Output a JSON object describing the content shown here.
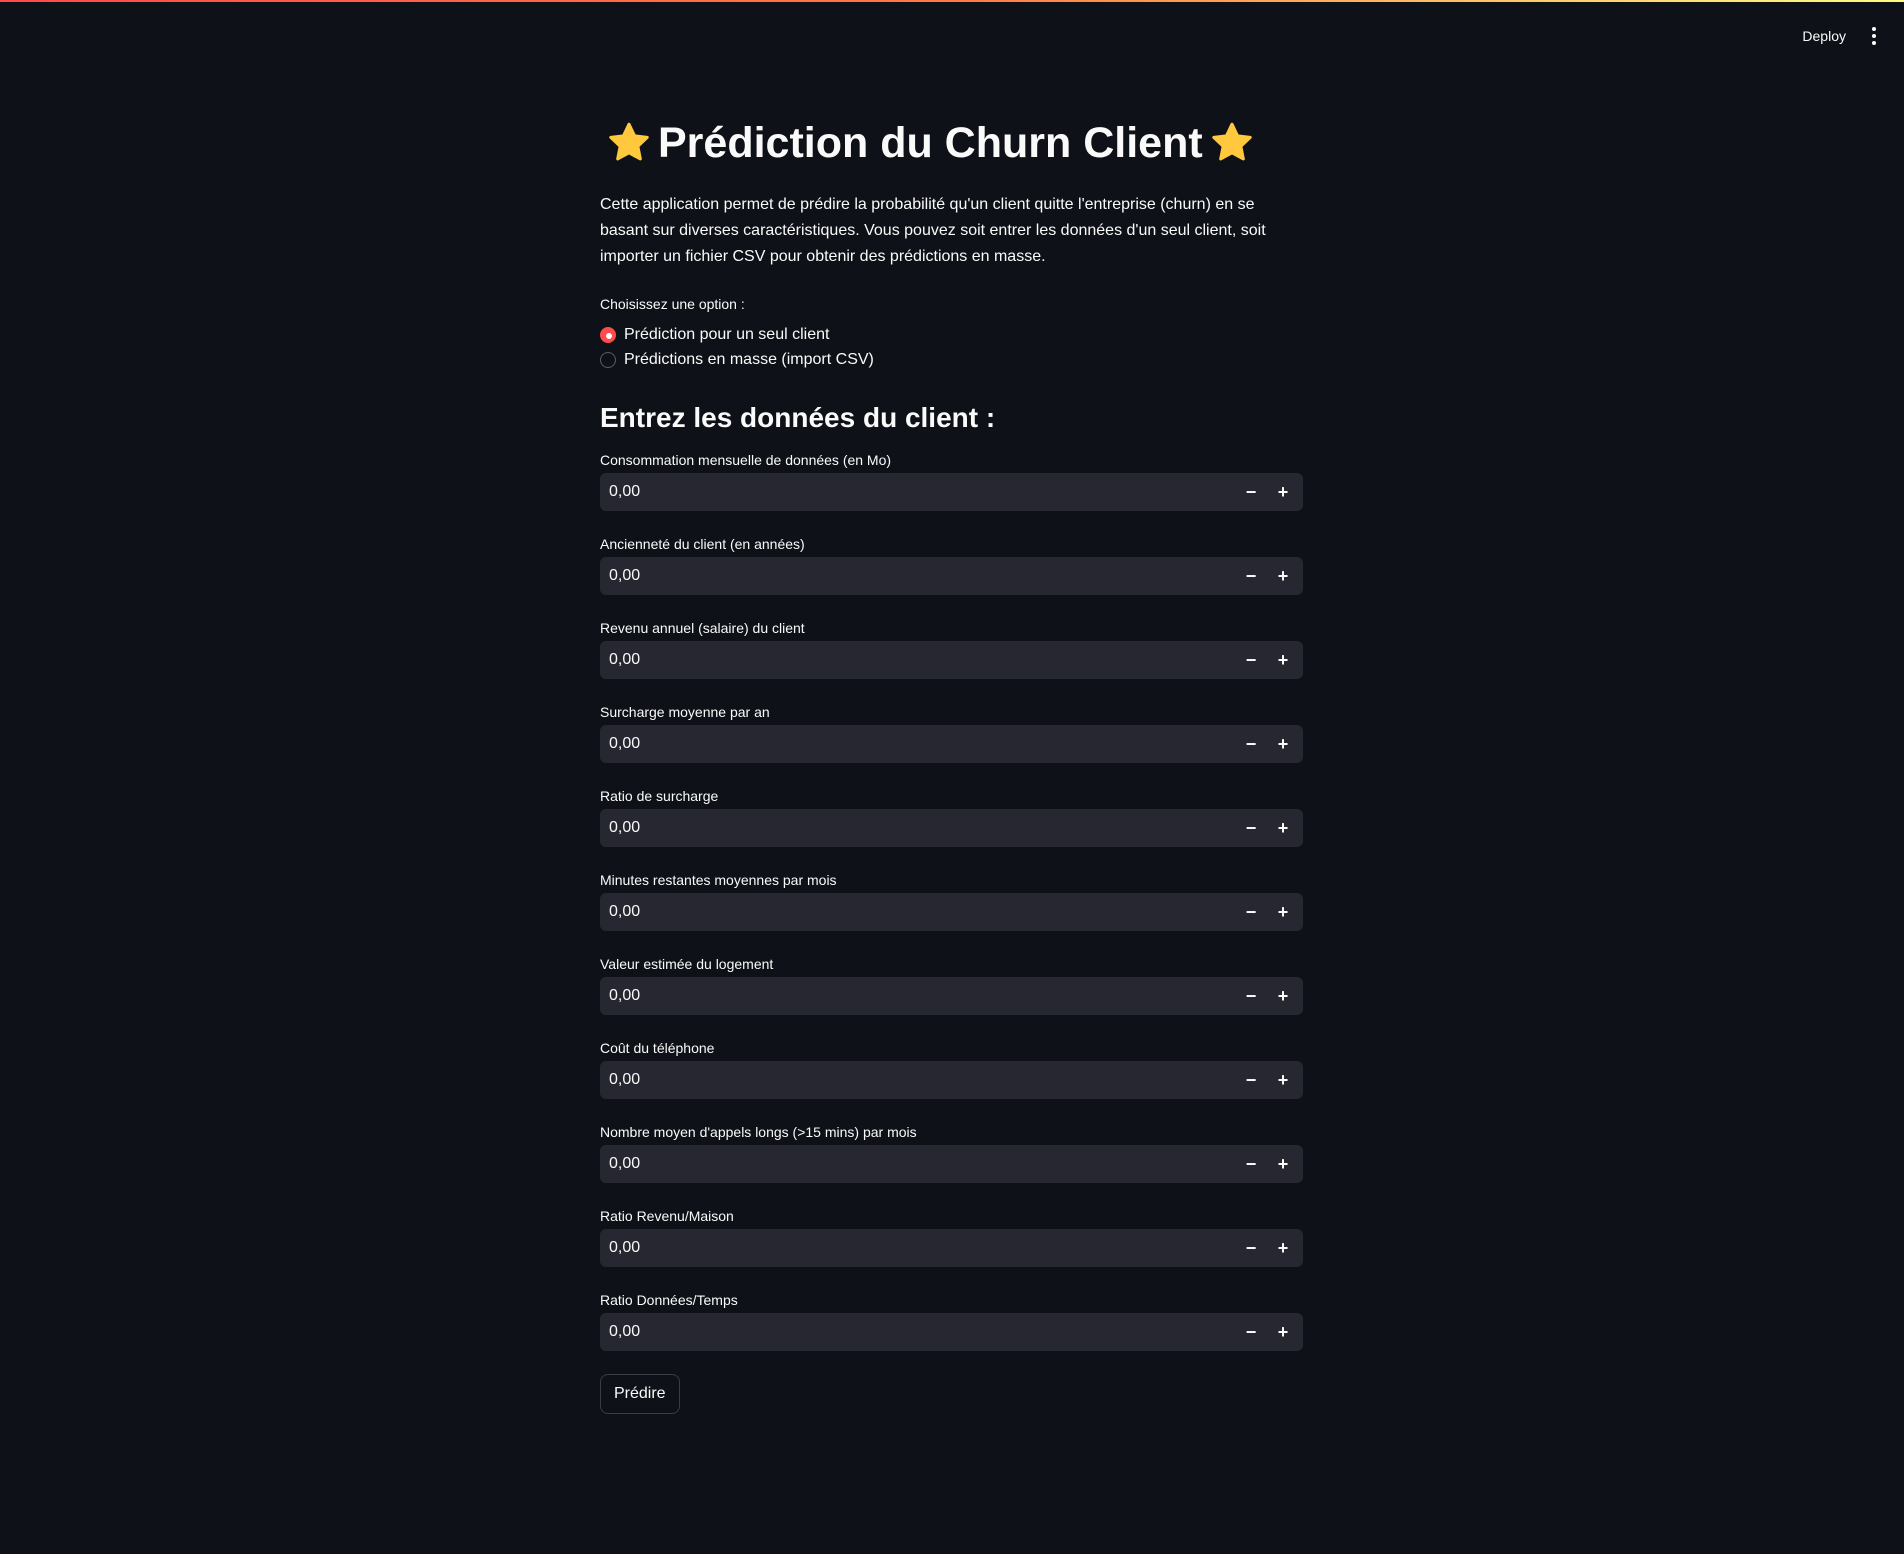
{
  "header": {
    "deploy_label": "Deploy",
    "menu_icon": "vertical-dots-icon"
  },
  "title": {
    "icon_left": "star-icon",
    "text": "Prédiction du Churn Client",
    "icon_right": "star-icon",
    "star_color": "#ffc83d"
  },
  "intro": "Cette application permet de prédire la probabilité qu'un client quitte l'entreprise (churn) en se basant sur diverses caractéristiques. Vous pouvez soit entrer les données d'un seul client, soit importer un fichier CSV pour obtenir des prédictions en masse.",
  "mode": {
    "label": "Choisissez une option :",
    "options": [
      {
        "label": "Prédiction pour un seul client",
        "selected": true
      },
      {
        "label": "Prédictions en masse (import CSV)",
        "selected": false
      }
    ]
  },
  "form": {
    "heading": "Entrez les données du client :",
    "fields": [
      {
        "label": "Consommation mensuelle de données (en Mo)",
        "value": "0,00"
      },
      {
        "label": "Ancienneté du client (en années)",
        "value": "0,00"
      },
      {
        "label": "Revenu annuel (salaire) du client",
        "value": "0,00"
      },
      {
        "label": "Surcharge moyenne par an",
        "value": "0,00"
      },
      {
        "label": "Ratio de surcharge",
        "value": "0,00"
      },
      {
        "label": "Minutes restantes moyennes par mois",
        "value": "0,00"
      },
      {
        "label": "Valeur estimée du logement",
        "value": "0,00"
      },
      {
        "label": "Coût du téléphone",
        "value": "0,00"
      },
      {
        "label": "Nombre moyen d'appels longs (>15 mins) par mois",
        "value": "0,00"
      },
      {
        "label": "Ratio Revenu/Maison",
        "value": "0,00"
      },
      {
        "label": "Ratio Données/Temps",
        "value": "0,00"
      }
    ],
    "stepper": {
      "minus": "−",
      "plus": "+"
    },
    "submit_label": "Prédire"
  },
  "colors": {
    "background": "#0e1117",
    "input_background": "#262730",
    "accent": "#ff4b4b"
  }
}
